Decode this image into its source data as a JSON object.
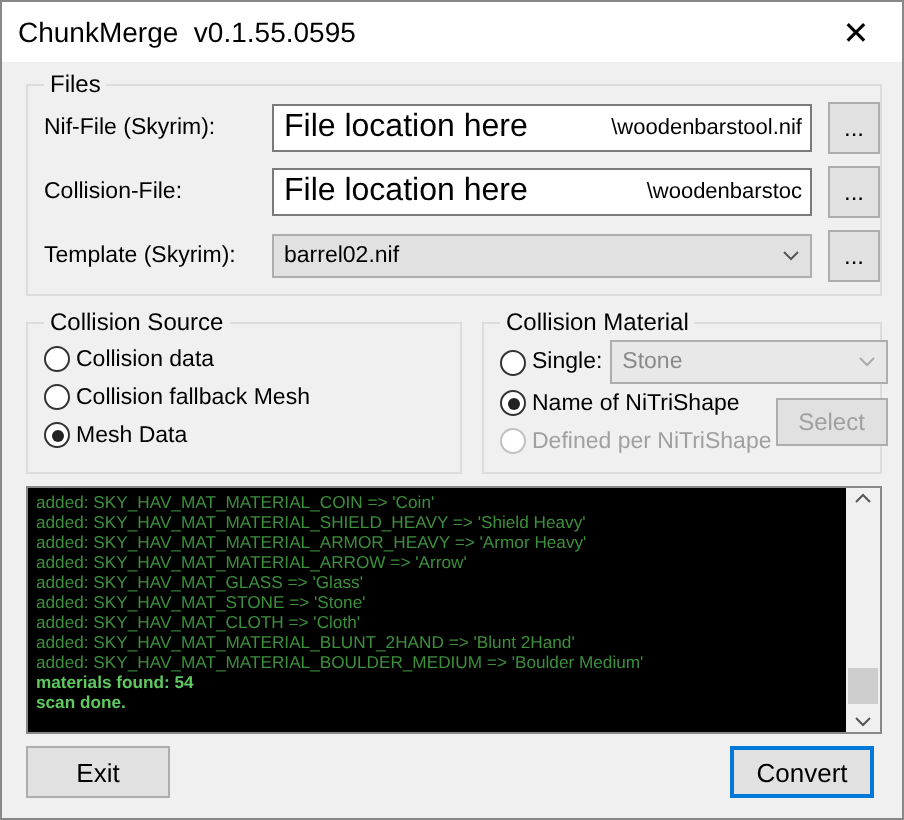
{
  "window": {
    "title": "ChunkMerge  v0.1.55.0595",
    "close": "✕"
  },
  "files": {
    "title": "Files",
    "rows": [
      {
        "kind": "text",
        "label": "Nif-File (Skyrim):",
        "overlay_text": "File location here",
        "value": "\\woodenbarstool.nif",
        "browse": "..."
      },
      {
        "kind": "text",
        "label": "Collision-File:",
        "overlay_text": "File location here",
        "value": "\\woodenbarstoc",
        "browse": "..."
      },
      {
        "kind": "combo",
        "label": "Template (Skyrim):",
        "value": "barrel02.nif",
        "browse": "..."
      }
    ]
  },
  "collision_source": {
    "title": "Collision Source",
    "options": [
      {
        "label": "Collision data",
        "selected": false
      },
      {
        "label": "Collision fallback Mesh",
        "selected": false
      },
      {
        "label": "Mesh Data",
        "selected": true
      }
    ]
  },
  "collision_material": {
    "title": "Collision Material",
    "options": [
      {
        "label": "Single:",
        "selected": false,
        "disabled": false,
        "combo": {
          "value": "Stone",
          "disabled": true
        }
      },
      {
        "label": "Name of NiTriShape",
        "selected": true,
        "disabled": false
      },
      {
        "label": "Defined per NiTriShape",
        "selected": false,
        "disabled": true
      }
    ],
    "select_button": {
      "label": "Select",
      "disabled": true
    }
  },
  "log": [
    {
      "kind": "added",
      "text": "added: SKY_HAV_MAT_MATERIAL_COIN => 'Coin'"
    },
    {
      "kind": "added",
      "text": "added: SKY_HAV_MAT_MATERIAL_SHIELD_HEAVY => 'Shield Heavy'"
    },
    {
      "kind": "added",
      "text": "added: SKY_HAV_MAT_MATERIAL_ARMOR_HEAVY => 'Armor Heavy'"
    },
    {
      "kind": "added",
      "text": "added: SKY_HAV_MAT_MATERIAL_ARROW => 'Arrow'"
    },
    {
      "kind": "added",
      "text": "added: SKY_HAV_MAT_GLASS => 'Glass'"
    },
    {
      "kind": "added",
      "text": "added: SKY_HAV_MAT_STONE => 'Stone'"
    },
    {
      "kind": "added",
      "text": "added: SKY_HAV_MAT_CLOTH => 'Cloth'"
    },
    {
      "kind": "added",
      "text": "added: SKY_HAV_MAT_MATERIAL_BLUNT_2HAND => 'Blunt 2Hand'"
    },
    {
      "kind": "added",
      "text": "added: SKY_HAV_MAT_MATERIAL_BOULDER_MEDIUM => 'Boulder Medium'"
    },
    {
      "kind": "summary",
      "text": "materials found: 54"
    },
    {
      "kind": "summary",
      "text": "scan done."
    }
  ],
  "buttons": [
    {
      "label": "Exit",
      "default": false
    },
    {
      "label": "Convert",
      "default": true
    }
  ]
}
